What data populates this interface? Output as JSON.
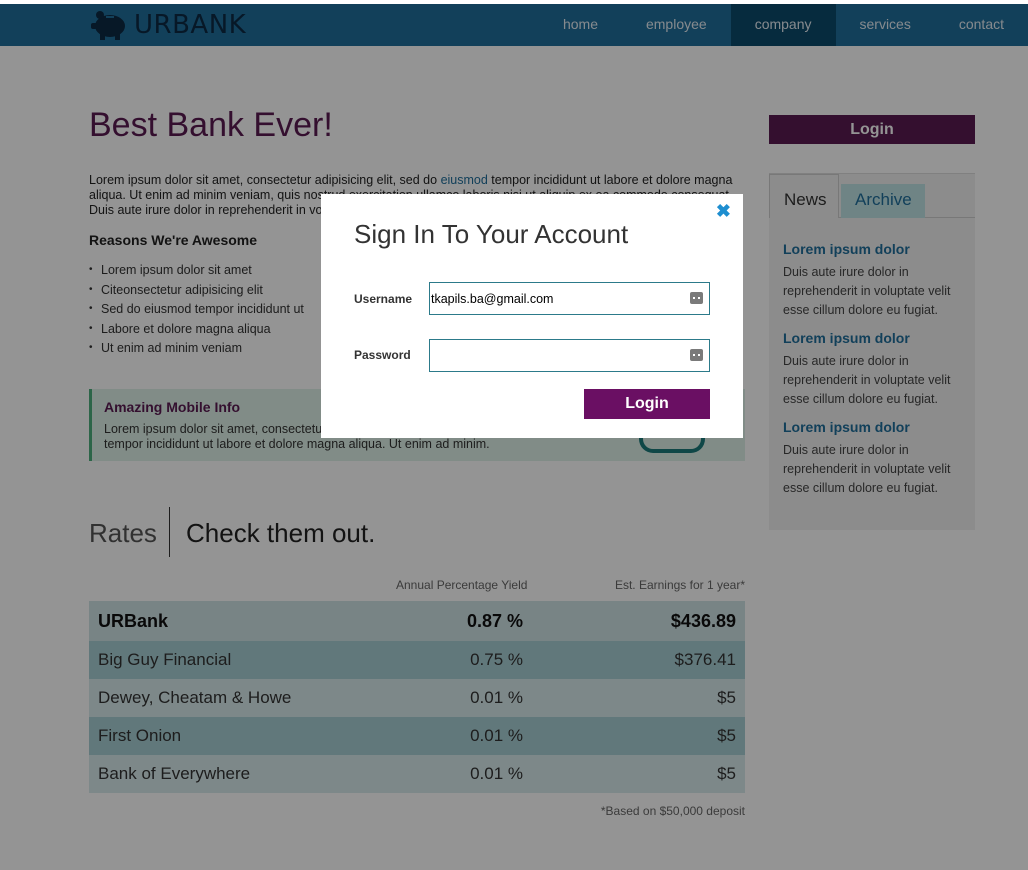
{
  "header": {
    "brand": "URBANK",
    "nav": [
      "home",
      "employee",
      "company",
      "services",
      "contact"
    ]
  },
  "main": {
    "title": "Best Bank Ever!",
    "intro_before_link": "Lorem ipsum dolor sit amet, consectetur adipisicing elit, sed do ",
    "intro_link": "eiusmod",
    "intro_after_link": " tempor incididunt ut labore et dolore magna aliqua. Ut enim ad minim veniam, quis nostrud exercitation ullamco laboris nisi ut aliquip ex ea commodo consequat. Duis aute irure dolor in reprehenderit in voluptate velit esse cillum dolore eu fugiat.",
    "reasons_title": "Reasons We're Awesome",
    "reasons": [
      "Lorem ipsum dolor sit amet",
      "Citeonsectetur adipisicing elit",
      "Sed do eiusmod tempor incididunt ut",
      "Labore et dolore magna aliqua",
      "Ut enim ad minim veniam"
    ],
    "mobile": {
      "title": "Amazing Mobile Info",
      "text": "Lorem ipsum dolor sit amet, consectetur adipisicing elit, sed do eiusmod tempor incididunt ut labore et dolore magna aliqua. Ut enim ad minim."
    },
    "rates": {
      "label": "Rates",
      "subtitle": "Check them out.",
      "col_apy": "Annual Percentage Yield",
      "col_earnings": "Est. Earnings for 1 year*",
      "rows": [
        {
          "bank": "URBank",
          "apy": "0.87 %",
          "earnings": "$436.89"
        },
        {
          "bank": "Big Guy Financial",
          "apy": "0.75 %",
          "earnings": "$376.41"
        },
        {
          "bank": "Dewey, Cheatam & Howe",
          "apy": "0.01 %",
          "earnings": "$5"
        },
        {
          "bank": "First Onion",
          "apy": "0.01 %",
          "earnings": "$5"
        },
        {
          "bank": "Bank of Everywhere",
          "apy": "0.01 %",
          "earnings": "$5"
        }
      ],
      "footnote": "*Based on $50,000 deposit"
    }
  },
  "sidebar": {
    "login_label": "Login",
    "tabs": [
      "News",
      "Archive"
    ],
    "news": [
      {
        "title": "Lorem ipsum dolor",
        "body": "Duis aute irure dolor in reprehenderit in voluptate velit esse cillum dolore eu fugiat."
      },
      {
        "title": "Lorem ipsum dolor",
        "body": "Duis aute irure dolor in reprehenderit in voluptate velit esse cillum dolore eu fugiat."
      },
      {
        "title": "Lorem ipsum dolor",
        "body": "Duis aute irure dolor in reprehenderit in voluptate velit esse cillum dolore eu fugiat."
      }
    ]
  },
  "modal": {
    "title": "Sign In To Your Account",
    "close_icon": "close-icon",
    "username_label": "Username",
    "username_value": "tkapils.ba@gmail.com",
    "password_label": "Password",
    "password_value": "",
    "login_label": "Login"
  },
  "colors": {
    "header": "#1f6e9b",
    "brand_purple": "#5b1b52",
    "button_purple": "#6a0f63",
    "link_blue": "#1f6e9b",
    "close_blue": "#1e8ed0"
  }
}
